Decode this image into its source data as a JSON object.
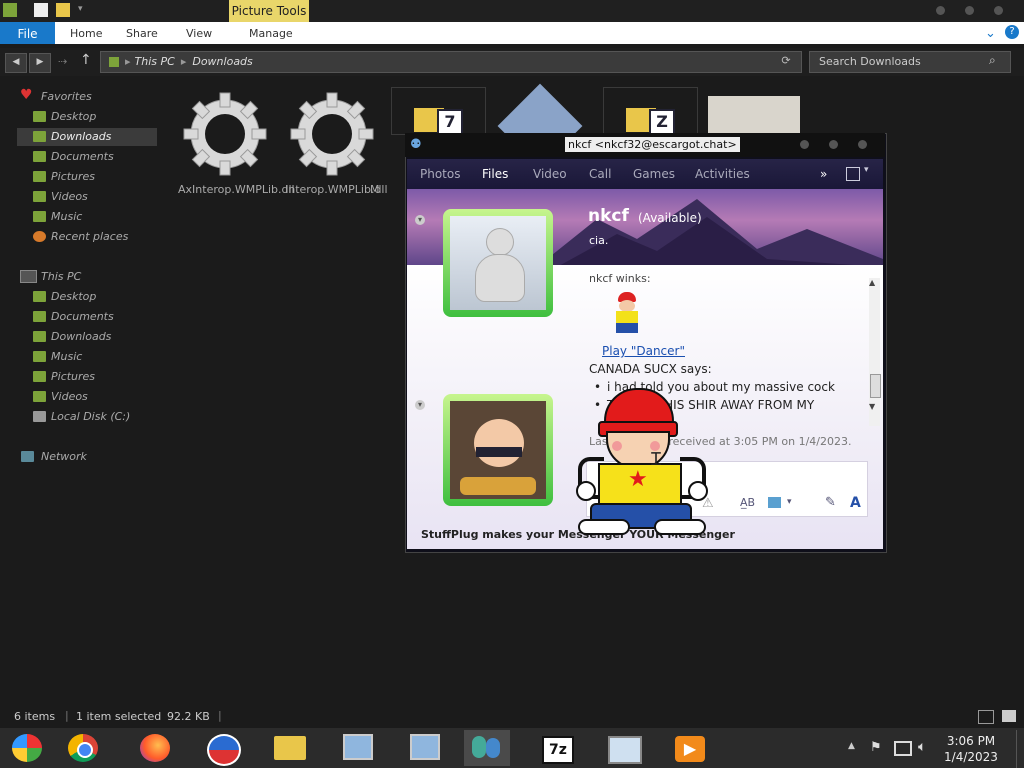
{
  "explorer": {
    "context_tab": "Picture Tools",
    "tabs": {
      "file": "File",
      "home": "Home",
      "share": "Share",
      "view": "View",
      "manage": "Manage"
    },
    "breadcrumb": {
      "root": "This PC",
      "current": "Downloads"
    },
    "search_placeholder": "Search Downloads",
    "sidebar": {
      "favorites": "Favorites",
      "fav_items": [
        "Desktop",
        "Downloads",
        "Documents",
        "Pictures",
        "Videos",
        "Music",
        "Recent places"
      ],
      "this_pc": "This PC",
      "pc_items": [
        "Desktop",
        "Documents",
        "Downloads",
        "Music",
        "Pictures",
        "Videos",
        "Local Disk (C:)"
      ],
      "network": "Network"
    },
    "files": [
      {
        "name": "AxInterop.WMPLib.dll"
      },
      {
        "name": "Interop.WMPLib.dll"
      },
      {
        "name": "M"
      }
    ],
    "status": {
      "count": "6 items",
      "selected": "1 item selected",
      "size": "92.2 KB"
    }
  },
  "messenger": {
    "title": "nkcf <nkcf32@escargot.chat>",
    "tabs": [
      "Photos",
      "Files",
      "Video",
      "Call",
      "Games",
      "Activities"
    ],
    "contact_name": "nkcf",
    "contact_status": "(Available)",
    "personal_message": "cia.",
    "wink_header": "nkcf winks:",
    "wink_link": "Play \"Dancer\"",
    "sender": "CANADA SUCX says:",
    "messages": [
      "i had told you about my massive cock",
      "THROW THIS SHIR AWAY FROM MY"
    ],
    "last_received": "Last message received at 3:05 PM on 1/4/2023.",
    "footer": "StuffPlug makes your Messenger YOUR Messenger"
  },
  "clock": {
    "time": "3:06 PM",
    "date": "1/4/2023"
  },
  "colors": {
    "accent": "#1979ca",
    "tab_highlight": "#e9d66a",
    "sidebar_icon": "#7da33a",
    "link": "#1a4fb0"
  }
}
